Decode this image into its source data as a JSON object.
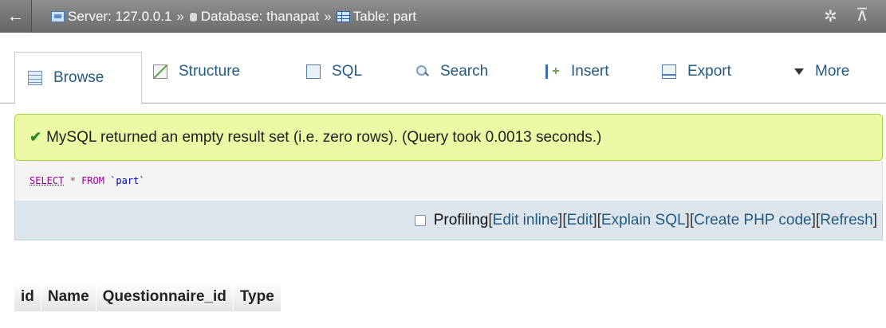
{
  "topbar": {
    "back_arrow": "←",
    "server_label": "Server: 127.0.0.1",
    "sep1": "»",
    "database_label": "Database: thanapat",
    "sep2": "»",
    "table_label": "Table: part",
    "gear_icon": "gear-icon",
    "collapse_icon": "collapse-icon"
  },
  "tabs": [
    {
      "label": "Browse",
      "icon": "browse-icon"
    },
    {
      "label": "Structure",
      "icon": "structure-icon"
    },
    {
      "label": "SQL",
      "icon": "sql-icon"
    },
    {
      "label": "Search",
      "icon": "search-icon"
    },
    {
      "label": "Insert",
      "icon": "insert-icon"
    },
    {
      "label": "Export",
      "icon": "export-icon"
    },
    {
      "label": "More",
      "icon": "caret-down-icon"
    }
  ],
  "message": {
    "text": "MySQL returned an empty result set (i.e. zero rows). (Query took 0.0013 seconds.)",
    "background": "#ebf8a4"
  },
  "query": {
    "select": "SELECT",
    "star": "*",
    "from": "FROM",
    "table": "`part`"
  },
  "actions": {
    "profiling": "Profiling",
    "edit_inline": "Edit inline",
    "edit": "Edit",
    "explain_sql": "Explain SQL",
    "create_php": "Create PHP code",
    "refresh": "Refresh"
  },
  "results": {
    "columns": [
      "id",
      "Name",
      "Questionnaire_id",
      "Type"
    ]
  },
  "colors": {
    "link": "#235a81",
    "topbar": "#7a7a7a",
    "success_border": "#a2d246"
  }
}
